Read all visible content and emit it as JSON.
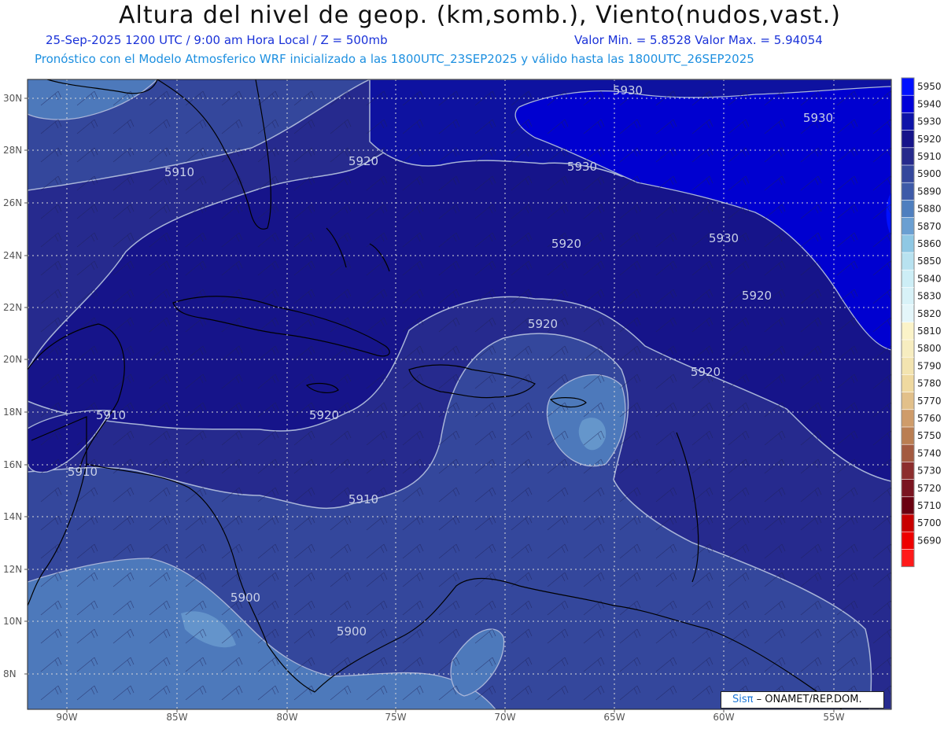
{
  "header": {
    "title": "Altura del nivel de geop. (km,somb.), Viento(nudos,vast.)",
    "date_line": "25-Sep-2025  1200 UTC / 9:00 am Hora Local / Z = 500mb",
    "range_line": "Valor Min. = 5.8528  Valor Max. = 5.94054",
    "forecast_line": "Pronóstico con el Modelo Atmosferico WRF inicializado a las 1800UTC_23SEP2025 y válido hasta las  1800UTC_26SEP2025"
  },
  "axes": {
    "lat_labels": [
      "30N",
      "28N",
      "26N",
      "24N",
      "22N",
      "20N",
      "18N",
      "16N",
      "14N",
      "12N",
      "10N",
      "8N"
    ],
    "lon_labels": [
      "90W",
      "85W",
      "80W",
      "75W",
      "70W",
      "65W",
      "60W",
      "55W"
    ]
  },
  "contour_labels": [
    "5930",
    "5930",
    "5930",
    "5930",
    "5920",
    "5920",
    "5920",
    "5920",
    "5920",
    "5920",
    "5910",
    "5910",
    "5910",
    "5910",
    "5900",
    "5900"
  ],
  "colorbar": {
    "levels": [
      "5950",
      "5940",
      "5930",
      "5920",
      "5910",
      "5900",
      "5890",
      "5880",
      "5870",
      "5860",
      "5850",
      "5840",
      "5830",
      "5820",
      "5810",
      "5800",
      "5790",
      "5780",
      "5770",
      "5760",
      "5750",
      "5740",
      "5730",
      "5720",
      "5710",
      "5700",
      "5690"
    ],
    "colors": [
      "#0010ff",
      "#0000d8",
      "#0e14a8",
      "#16148a",
      "#262a8c",
      "#34479c",
      "#3e5aa8",
      "#4f7fbf",
      "#6a9fd2",
      "#8fc8e4",
      "#b8e2f0",
      "#cdeef6",
      "#d8f2f8",
      "#e4f6fa",
      "#fbf3c8",
      "#f7edc0",
      "#f3e4b0",
      "#efd9a0",
      "#e2c08a",
      "#cf9c6a",
      "#ba7e52",
      "#a35a40",
      "#8c2d2d",
      "#7a1420",
      "#6a0010",
      "#c80000",
      "#ee0000",
      "#ff1a1a"
    ]
  },
  "colors": {
    "c5930": "#0e12a0",
    "c5920": "#17148a",
    "c5910": "#262a8e",
    "c5900": "#33479c",
    "c5890": "#4d79bb",
    "c5880": "#6c9ed0",
    "coast": "#000000",
    "grid": "#d8d8d8"
  },
  "watermark": {
    "brand": "Sisπ",
    "text": "– ONAMET/REP.DOM."
  }
}
